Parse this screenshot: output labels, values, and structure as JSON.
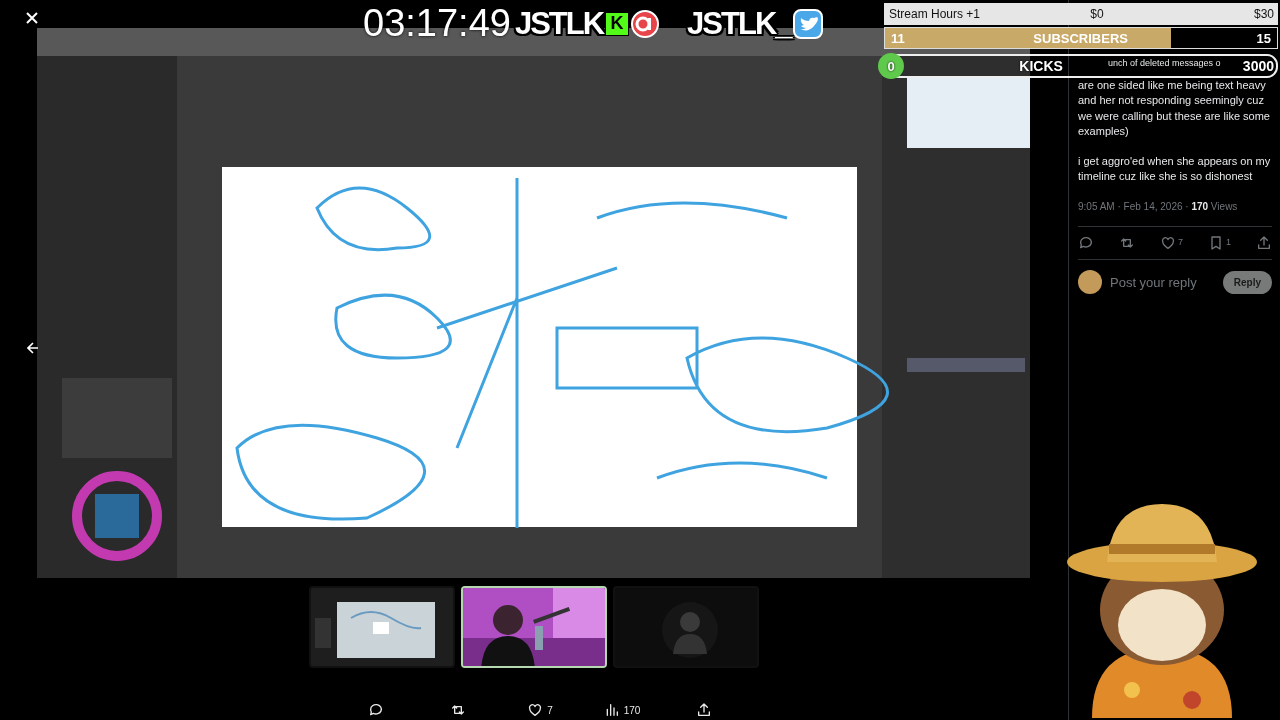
{
  "overlay": {
    "timer": "03:17:49",
    "channels": [
      {
        "kind": "kick",
        "handle": "JSTLK",
        "badge": "K"
      },
      {
        "kind": "twitter",
        "handle": "JSTLK_"
      }
    ],
    "goal": {
      "title": "Stream Hours +1",
      "start": "$0",
      "end": "$30"
    },
    "subscribers": {
      "label": "SUBSCRIBERS",
      "current": "11",
      "target": "15",
      "level": 0.73
    },
    "kicks": {
      "label": "KICKS",
      "current": "0",
      "target": "3000"
    }
  },
  "viewer": {
    "thumbnails": [
      {
        "selected": false
      },
      {
        "selected": true
      },
      {
        "selected": false
      }
    ],
    "actions": [
      {
        "kind": "reply"
      },
      {
        "kind": "repost"
      },
      {
        "kind": "like",
        "count": "7"
      },
      {
        "kind": "views",
        "count": "170"
      },
      {
        "kind": "share"
      }
    ]
  },
  "tweet": {
    "fragment": "unch of deleted messages o",
    "paragraphs": [
      "are one sided like me being text heavy and her not responding seemingly cuz we were calling but these are like some examples)",
      "i get aggro'ed when she appears on my timeline cuz like she is so dishonest"
    ],
    "meta": "9:05 AM · Feb 14, 2026 · **170** Views",
    "actions": [
      {
        "kind": "reply"
      },
      {
        "kind": "repost"
      },
      {
        "kind": "like",
        "count": "7"
      },
      {
        "kind": "bookmark",
        "count": "1"
      },
      {
        "kind": "share"
      }
    ],
    "reply": {
      "placeholder": "Post your reply",
      "button": "Reply",
      "disabled": true
    }
  }
}
